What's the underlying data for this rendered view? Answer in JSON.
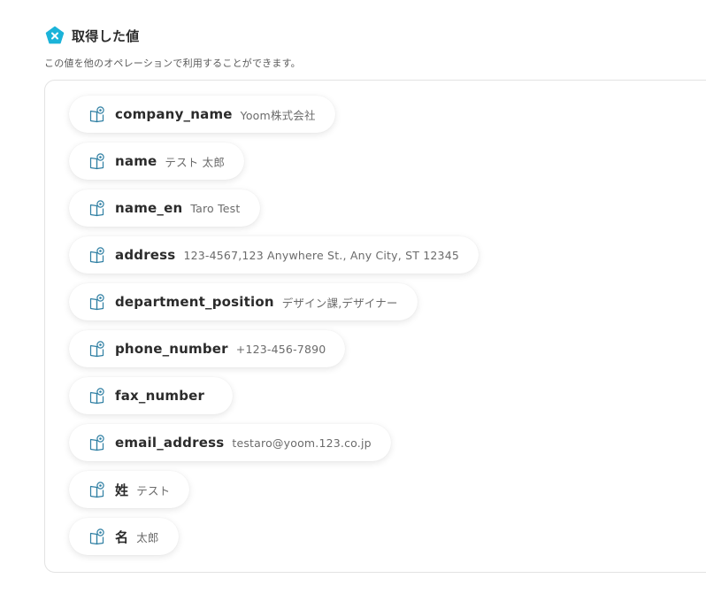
{
  "header": {
    "icon": "yoom-pentagon-icon",
    "icon_color": "#1bb3d9",
    "title": "取得した値",
    "description": "この値を他のオペレーションで利用することができます。"
  },
  "outputs": [
    {
      "key": "company_name",
      "value": "Yoom株式会社",
      "icon": "output-book-icon"
    },
    {
      "key": "name",
      "value": "テスト 太郎",
      "icon": "output-book-icon"
    },
    {
      "key": "name_en",
      "value": "Taro Test",
      "icon": "output-book-icon"
    },
    {
      "key": "address",
      "value": "123-4567,123 Anywhere St., Any City, ST 12345",
      "icon": "output-book-icon"
    },
    {
      "key": "department_position",
      "value": "デザイン課,デザイナー",
      "icon": "output-book-icon"
    },
    {
      "key": "phone_number",
      "value": "+123-456-7890",
      "icon": "output-book-icon"
    },
    {
      "key": "fax_number",
      "value": "",
      "icon": "output-book-icon"
    },
    {
      "key": "email_address",
      "value": "testaro@yoom.123.co.jp",
      "icon": "output-book-icon"
    },
    {
      "key": "姓",
      "value": "テスト",
      "icon": "output-book-icon"
    },
    {
      "key": "名",
      "value": "太郎",
      "icon": "output-book-icon"
    }
  ],
  "colors": {
    "accent": "#1bb3d9",
    "icon_stroke": "#2f7fa3",
    "text_primary": "#2b2b2b",
    "text_secondary": "#6b6b6b",
    "panel_border": "#e3e3e3"
  }
}
